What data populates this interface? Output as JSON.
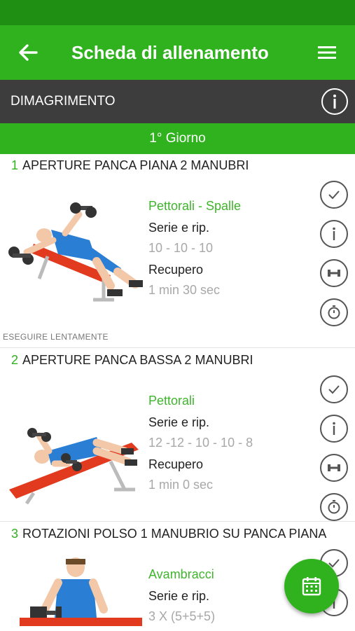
{
  "header": {
    "title": "Scheda di allenamento"
  },
  "program": {
    "name": "DIMAGRIMENTO"
  },
  "day": {
    "label": "1° Giorno"
  },
  "labels": {
    "sets": "Serie e rip.",
    "rest": "Recupero"
  },
  "exercises": [
    {
      "number": "1",
      "name": "APERTURE PANCA PIANA 2 MANUBRI",
      "muscles": "Pettorali - Spalle",
      "sets": "10 - 10 - 10",
      "rest": "1 min 30 sec",
      "note": "ESEGUIRE LENTAMENTE"
    },
    {
      "number": "2",
      "name": "APERTURE PANCA BASSA 2 MANUBRI",
      "muscles": "Pettorali",
      "sets": "12 -12 - 10 - 10 - 8",
      "rest": "1 min 0 sec"
    },
    {
      "number": "3",
      "name": "ROTAZIONI POLSO 1 MANUBRIO SU PANCA PIANA",
      "muscles": "Avambracci",
      "sets": "3 X (5+5+5)"
    }
  ],
  "icons": {
    "back": "arrow-left-icon",
    "menu": "hamburger-menu-icon",
    "info": "info-icon",
    "done": "check-icon",
    "details": "info-icon",
    "weights": "dumbbell-icon",
    "timer": "stopwatch-icon",
    "fab": "calendar-icon"
  },
  "colors": {
    "primary": "#2fb21e",
    "statusbar": "#1e8f12",
    "program_bar": "#3d3d3d",
    "muscle_text": "#3fb52c"
  }
}
